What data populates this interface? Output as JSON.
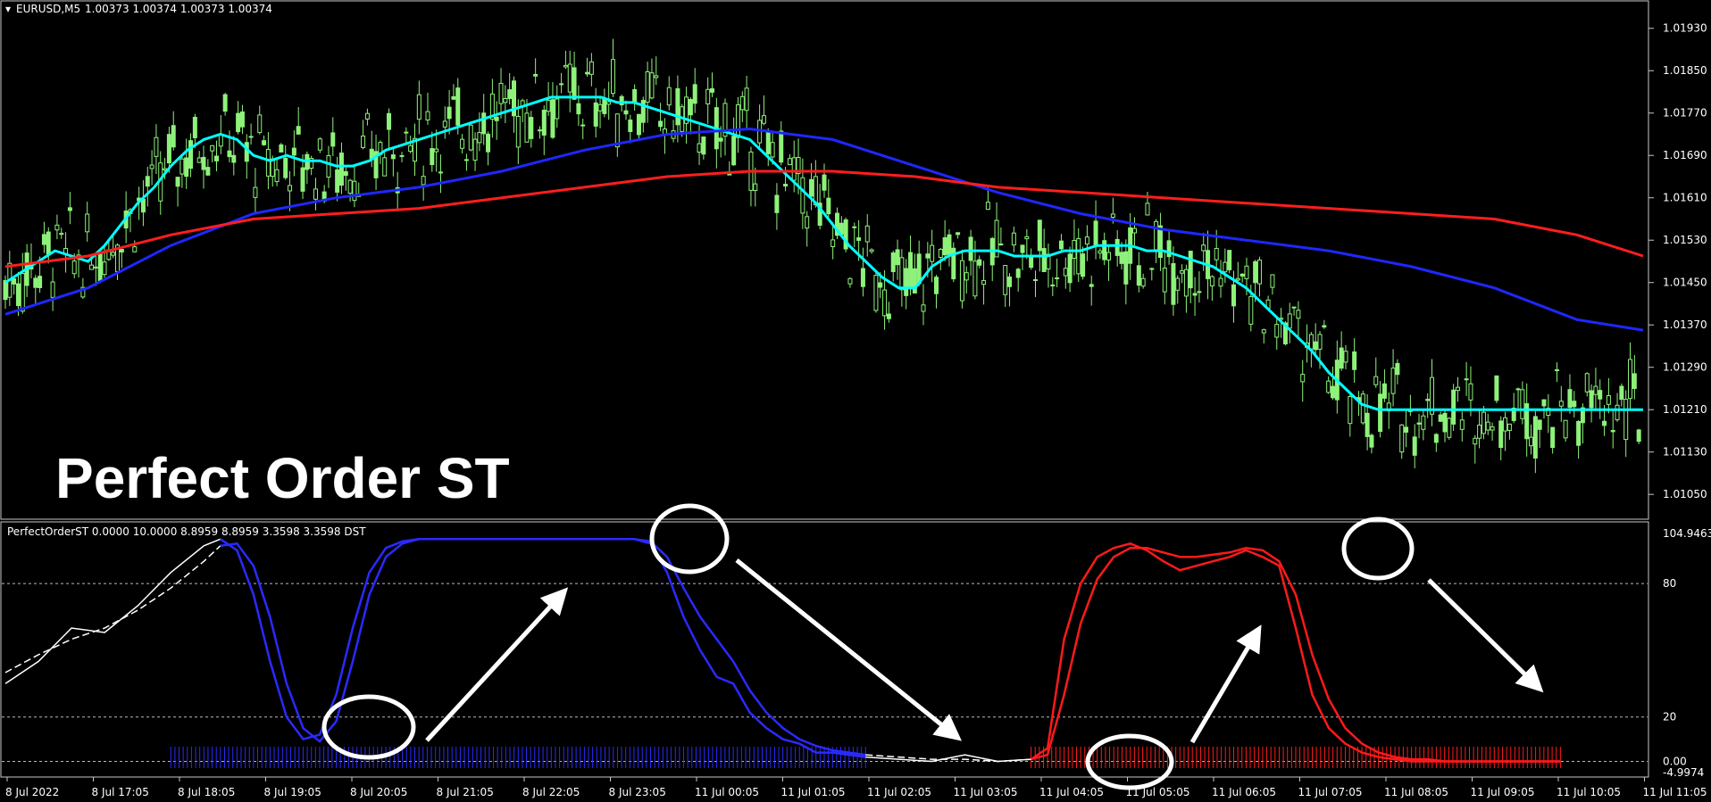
{
  "main_header": {
    "symbol": "EURUSD,M5",
    "ohlc": "1.00373 1.00374 1.00373 1.00374"
  },
  "overlay_title": "Perfect Order ST",
  "indicator_header": "PerfectOrderST 0.0000 10.0000 8.8959 8.8959 3.3598 3.3598  DST",
  "colors": {
    "background": "#000000",
    "grid_border": "#c8c8c8",
    "candle": "#8ef27a",
    "ma_fast": "#00ffff",
    "ma_mid": "#1e28ff",
    "ma_slow": "#ff1e1e",
    "osc_blue": "#2a2aff",
    "osc_red": "#ff1a1a",
    "osc_white": "#ffffff",
    "annotation": "#ffffff"
  },
  "chart_data": [
    {
      "type": "candlestick",
      "price_ticks": [
        "1.01930",
        "1.01850",
        "1.01770",
        "1.01690",
        "1.01610",
        "1.01530",
        "1.01450",
        "1.01370",
        "1.01290",
        "1.01210",
        "1.01130",
        "1.01050"
      ],
      "ylim": [
        1.0102,
        1.0197
      ],
      "series": [
        {
          "name": "MA fast",
          "color_key": "ma_fast",
          "x": [
            0,
            2,
            4,
            6,
            8,
            10,
            12,
            14,
            16,
            18,
            20,
            22,
            24,
            26,
            28,
            30,
            32,
            34,
            36,
            38,
            40,
            42,
            44,
            46,
            48,
            50,
            52,
            54,
            56,
            58,
            60,
            62,
            64,
            66,
            68,
            70,
            72,
            74,
            76,
            78,
            80,
            82,
            84,
            86,
            88,
            90,
            92,
            94,
            96,
            98,
            100,
            102,
            104,
            106,
            108,
            110,
            112,
            114,
            116,
            118,
            120,
            122,
            124,
            126,
            128,
            130,
            132,
            134,
            136,
            138,
            140,
            142,
            144,
            146,
            148,
            150,
            152,
            154,
            156,
            158,
            160,
            162,
            164,
            166,
            168,
            170,
            172,
            174,
            176,
            178,
            180,
            182,
            184,
            186,
            188,
            190,
            192,
            194,
            196,
            198
          ],
          "y": [
            1.0145,
            1.0147,
            1.0149,
            1.0151,
            1.015,
            1.0149,
            1.0152,
            1.0156,
            1.016,
            1.0163,
            1.0167,
            1.017,
            1.0172,
            1.0173,
            1.0172,
            1.0169,
            1.0168,
            1.0169,
            1.0168,
            1.0168,
            1.0167,
            1.0167,
            1.0168,
            1.017,
            1.0171,
            1.0172,
            1.0173,
            1.0174,
            1.0175,
            1.0176,
            1.0177,
            1.0178,
            1.0179,
            1.018,
            1.018,
            1.018,
            1.018,
            1.0179,
            1.0179,
            1.0178,
            1.0177,
            1.0176,
            1.0175,
            1.0174,
            1.0173,
            1.0172,
            1.0169,
            1.0166,
            1.0163,
            1.016,
            1.0156,
            1.0152,
            1.0149,
            1.0146,
            1.0144,
            1.0144,
            1.0148,
            1.015,
            1.0151,
            1.0151,
            1.0151,
            1.015,
            1.015,
            1.015,
            1.0151,
            1.0151,
            1.0152,
            1.0152,
            1.0152,
            1.0151,
            1.0151,
            1.015,
            1.0149,
            1.0148,
            1.0146,
            1.0144,
            1.0141,
            1.0138,
            1.0135,
            1.0132,
            1.0128,
            1.0125,
            1.0122,
            1.0121,
            1.0121,
            1.0121,
            1.0121,
            1.0121,
            1.0121,
            1.0121,
            1.0121,
            1.0121,
            1.0121,
            1.0121,
            1.0121,
            1.0121,
            1.0121,
            1.0121,
            1.0121,
            1.0121
          ]
        },
        {
          "name": "MA mid",
          "color_key": "ma_mid",
          "x": [
            0,
            10,
            20,
            30,
            40,
            50,
            60,
            70,
            80,
            90,
            100,
            110,
            120,
            130,
            140,
            150,
            160,
            170,
            180,
            190,
            198
          ],
          "y": [
            1.0139,
            1.0144,
            1.0152,
            1.0158,
            1.0161,
            1.0163,
            1.0166,
            1.017,
            1.0173,
            1.0174,
            1.0172,
            1.0167,
            1.0162,
            1.0158,
            1.0155,
            1.0153,
            1.0151,
            1.0148,
            1.0144,
            1.0138,
            1.0136
          ]
        },
        {
          "name": "MA slow",
          "color_key": "ma_slow",
          "x": [
            0,
            10,
            20,
            30,
            40,
            50,
            60,
            70,
            80,
            90,
            100,
            110,
            120,
            130,
            140,
            150,
            160,
            170,
            180,
            190,
            198
          ],
          "y": [
            1.0148,
            1.015,
            1.0154,
            1.0157,
            1.0158,
            1.0159,
            1.0161,
            1.0163,
            1.0165,
            1.0166,
            1.0166,
            1.0165,
            1.0163,
            1.0162,
            1.0161,
            1.016,
            1.0159,
            1.0158,
            1.0157,
            1.0154,
            1.015
          ]
        }
      ]
    },
    {
      "type": "line",
      "level_ticks": [
        "104.9463",
        "80",
        "20",
        "0.00",
        "-4.9974"
      ],
      "levels": [
        80,
        20,
        0
      ],
      "ylim": [
        -4.9974,
        104.9463
      ],
      "x_labels": [
        "8 Jul 2022",
        "8 Jul 17:05",
        "8 Jul 18:05",
        "8 Jul 19:05",
        "8 Jul 20:05",
        "8 Jul 21:05",
        "8 Jul 22:05",
        "8 Jul 23:05",
        "11 Jul 00:05",
        "11 Jul 01:05",
        "11 Jul 02:05",
        "11 Jul 03:05",
        "11 Jul 04:05",
        "11 Jul 05:05",
        "11 Jul 06:05",
        "11 Jul 07:05",
        "11 Jul 08:05",
        "11 Jul 09:05",
        "11 Jul 10:05",
        "11 Jul 11:05"
      ],
      "series": [
        {
          "name": "fast",
          "segments": [
            {
              "color_key": "osc_white",
              "x": [
                0,
                4,
                8,
                12,
                16,
                20,
                24,
                26
              ],
              "y": [
                35,
                45,
                60,
                58,
                70,
                85,
                97,
                100
              ]
            },
            {
              "color_key": "osc_blue",
              "x": [
                26,
                28,
                30,
                32,
                34,
                36,
                38,
                40,
                42,
                44,
                46,
                48,
                50,
                52,
                54,
                56,
                58,
                60,
                62,
                64,
                66,
                68,
                70,
                72,
                74,
                76,
                78,
                80,
                82,
                84,
                86,
                88,
                90,
                92,
                94,
                96,
                98,
                100,
                102,
                104
              ],
              "y": [
                100,
                95,
                75,
                45,
                20,
                10,
                12,
                30,
                60,
                85,
                96,
                99,
                100,
                100,
                100,
                100,
                100,
                100,
                100,
                100,
                100,
                100,
                100,
                100,
                100,
                100,
                98,
                85,
                65,
                50,
                38,
                35,
                22,
                15,
                10,
                8,
                4,
                4,
                3,
                2
              ]
            },
            {
              "color_key": "osc_white",
              "x": [
                104,
                108,
                112,
                116,
                120,
                124
              ],
              "y": [
                2,
                1,
                0,
                3,
                0,
                1
              ]
            },
            {
              "color_key": "osc_red",
              "x": [
                124,
                126,
                128,
                130,
                132,
                134,
                136,
                138,
                140,
                142,
                144,
                146,
                148,
                150,
                152,
                154,
                156,
                158,
                160,
                162,
                164,
                166,
                168,
                170,
                172,
                174,
                176,
                178,
                180,
                182,
                184,
                186,
                188
              ],
              "y": [
                1,
                6,
                55,
                80,
                92,
                96,
                98,
                95,
                90,
                86,
                88,
                90,
                92,
                95,
                92,
                88,
                60,
                30,
                15,
                8,
                4,
                2,
                1,
                0,
                0,
                0,
                0,
                0,
                0,
                0,
                0,
                0,
                0
              ]
            }
          ]
        },
        {
          "name": "slow",
          "segments": [
            {
              "color_key": "osc_white",
              "x": [
                0,
                4,
                8,
                12,
                16,
                20,
                24,
                26
              ],
              "y": [
                40,
                48,
                55,
                60,
                68,
                78,
                90,
                97
              ]
            },
            {
              "color_key": "osc_blue",
              "x": [
                26,
                28,
                30,
                32,
                34,
                36,
                38,
                40,
                42,
                44,
                46,
                48,
                50,
                52,
                54,
                56,
                58,
                60,
                62,
                64,
                66,
                68,
                70,
                72,
                74,
                76,
                78,
                80,
                82,
                84,
                86,
                88,
                90,
                92,
                94,
                96,
                98,
                100,
                102,
                104
              ],
              "y": [
                97,
                98,
                88,
                65,
                35,
                15,
                9,
                18,
                45,
                75,
                92,
                98,
                100,
                100,
                100,
                100,
                100,
                100,
                100,
                100,
                100,
                100,
                100,
                100,
                100,
                100,
                99,
                92,
                78,
                65,
                55,
                45,
                32,
                22,
                15,
                10,
                7,
                5,
                4,
                3
              ]
            },
            {
              "color_key": "osc_white",
              "x": [
                104,
                108,
                112,
                116,
                120,
                124
              ],
              "y": [
                3,
                2,
                1,
                1,
                0,
                1
              ]
            },
            {
              "color_key": "osc_red",
              "x": [
                124,
                126,
                128,
                130,
                132,
                134,
                136,
                138,
                140,
                142,
                144,
                146,
                148,
                150,
                152,
                154,
                156,
                158,
                160,
                162,
                164,
                166,
                168,
                170,
                172,
                174,
                176,
                178,
                180,
                182,
                184,
                186,
                188
              ],
              "y": [
                1,
                3,
                30,
                62,
                82,
                92,
                96,
                96,
                94,
                92,
                92,
                93,
                94,
                96,
                95,
                90,
                75,
                48,
                28,
                15,
                8,
                4,
                2,
                1,
                1,
                0,
                0,
                0,
                0,
                0,
                0,
                0,
                0
              ]
            }
          ]
        }
      ],
      "histogram": [
        {
          "color_key": "osc_blue",
          "x_range": [
            20,
            104
          ]
        },
        {
          "color_key": "osc_red",
          "x_range": [
            124,
            188
          ]
        }
      ]
    }
  ]
}
